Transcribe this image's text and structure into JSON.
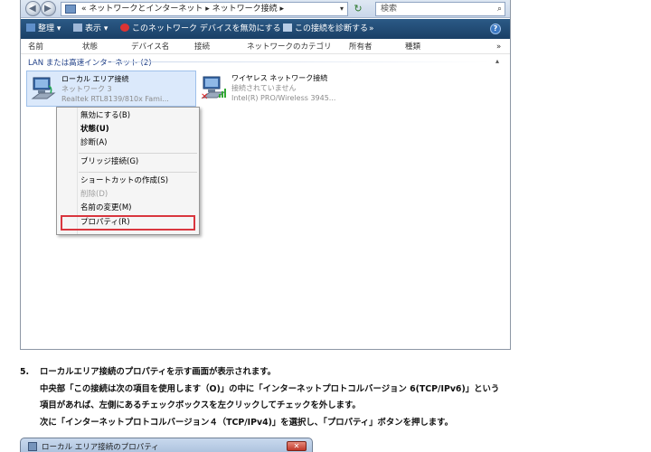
{
  "explorer": {
    "breadcrumb": "« ネットワークとインターネット ▸ ネットワーク接続 ▸",
    "search_placeholder": "検索",
    "toolbar": {
      "organize": "整理 ▾",
      "views": "表示 ▾",
      "disable_device": "このネットワーク デバイスを無効にする",
      "diagnose": "この接続を診断する",
      "more": "»"
    },
    "columns": [
      "名前",
      "状態",
      "デバイス名",
      "接続",
      "ネットワークのカテゴリ",
      "所有者",
      "種類",
      "»"
    ],
    "group_header": "LAN または高速インターネット (2)",
    "items": [
      {
        "name": "ローカル エリア接続",
        "status": "ネットワーク 3",
        "device": "Realtek RTL8139/810x Fami..."
      },
      {
        "name": "ワイヤレス ネットワーク接続",
        "status": "接続されていません",
        "device": "Intel(R) PRO/Wireless 3945..."
      }
    ],
    "context_menu": {
      "items": [
        {
          "label": "無効にする(B)",
          "style": "normal"
        },
        {
          "label": "状態(U)",
          "style": "bold"
        },
        {
          "label": "診断(A)",
          "style": "normal"
        },
        {
          "label": "ブリッジ接続(G)",
          "style": "normal"
        },
        {
          "label": "ショートカットの作成(S)",
          "style": "normal"
        },
        {
          "label": "削除(D)",
          "style": "disabled"
        },
        {
          "label": "名前の変更(M)",
          "style": "normal"
        },
        {
          "label": "プロパティ(R)",
          "style": "normal"
        }
      ],
      "highlighted": "プロパティ(R)",
      "highlight_color": "#d9363e"
    }
  },
  "instructions": {
    "step_number": "5.",
    "lines": [
      "ローカルエリア接続のプロパティを示す画面が表示されます。",
      "中央部「この接続は次の項目を使用します（O)」の中に「インターネットプロトコルバージョン 6(TCP/IPv6)」という",
      "項目があれば、左側にあるチェックボックスを左クリックしてチェックを外します。",
      "次に「インターネットプロトコルバージョン４（TCP/IPv4)」を選択し、「プロパティ」ボタンを押します。"
    ]
  },
  "dialog": {
    "title": "ローカル エリア接続のプロパティ",
    "close_label": "✕"
  },
  "colors": {
    "toolbar_bg": "#1a3f66",
    "selection_bg": "#dbe9fb",
    "highlight_border": "#d9363e"
  }
}
